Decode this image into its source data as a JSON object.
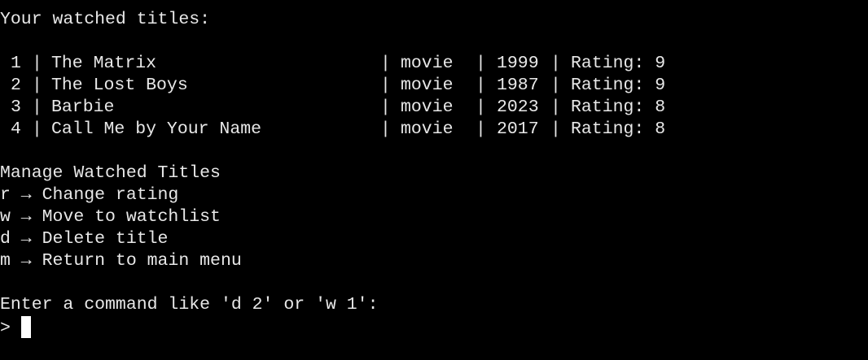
{
  "header": "Your watched titles:",
  "titles": [
    {
      "num": "1",
      "title": "The Matrix",
      "type": "movie",
      "year": "1999",
      "rating": "Rating: 9"
    },
    {
      "num": "2",
      "title": "The Lost Boys",
      "type": "movie",
      "year": "1987",
      "rating": "Rating: 9"
    },
    {
      "num": "3",
      "title": "Barbie",
      "type": "movie",
      "year": "2023",
      "rating": "Rating: 8"
    },
    {
      "num": "4",
      "title": "Call Me by Your Name",
      "type": "movie",
      "year": "2017",
      "rating": "Rating: 8"
    }
  ],
  "separator": "|",
  "menu": {
    "title": "Manage Watched Titles",
    "items": [
      "r → Change rating",
      "w → Move to watchlist",
      "d → Delete title",
      "m → Return to main menu"
    ]
  },
  "command_prompt": "Enter a command like 'd 2' or 'w 1':",
  "input_marker": ">"
}
